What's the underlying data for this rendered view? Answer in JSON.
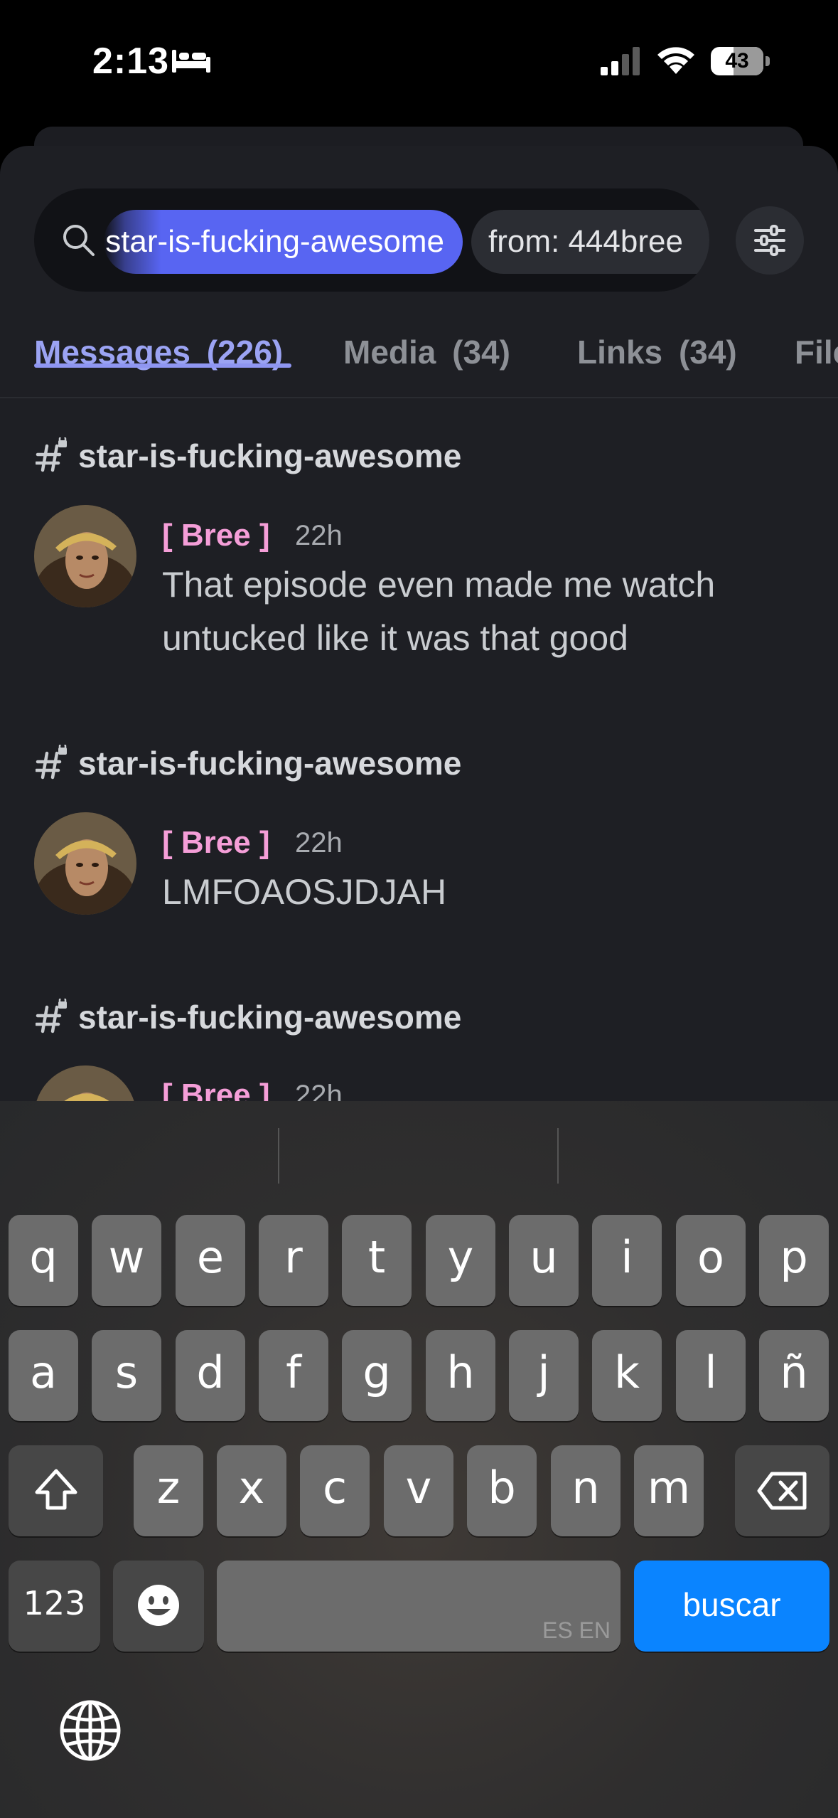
{
  "status_bar": {
    "time": "2:13",
    "battery": "43"
  },
  "search": {
    "channel_chip": "star-is-fucking-awesome",
    "from_chip": "from: 444bree"
  },
  "tabs": [
    {
      "label": "Messages",
      "count": "(226)"
    },
    {
      "label": "Media",
      "count": "(34)"
    },
    {
      "label": "Links",
      "count": "(34)"
    },
    {
      "label": "Files",
      "count": ""
    }
  ],
  "results": [
    {
      "channel": "star-is-fucking-awesome",
      "author": "[ Bree ]",
      "time": "22h",
      "text": "That episode even made me watch untucked like it was that good"
    },
    {
      "channel": "star-is-fucking-awesome",
      "author": "[ Bree ]",
      "time": "22h",
      "text": "LMFOAOSJDJAH"
    },
    {
      "channel": "star-is-fucking-awesome",
      "author": "[ Bree ]",
      "time": "22h",
      "text": ""
    }
  ],
  "keyboard": {
    "row1": [
      "q",
      "w",
      "e",
      "r",
      "t",
      "y",
      "u",
      "i",
      "o",
      "p"
    ],
    "row2": [
      "a",
      "s",
      "d",
      "f",
      "g",
      "h",
      "j",
      "k",
      "l",
      "ñ"
    ],
    "row3": [
      "z",
      "x",
      "c",
      "v",
      "b",
      "n",
      "m"
    ],
    "numbers_label": "123",
    "space_hint": "ES EN",
    "search_label": "buscar"
  },
  "colors": {
    "accent": "#5865f2",
    "author": "#f59ed8",
    "keyboard_search": "#0a84ff"
  }
}
